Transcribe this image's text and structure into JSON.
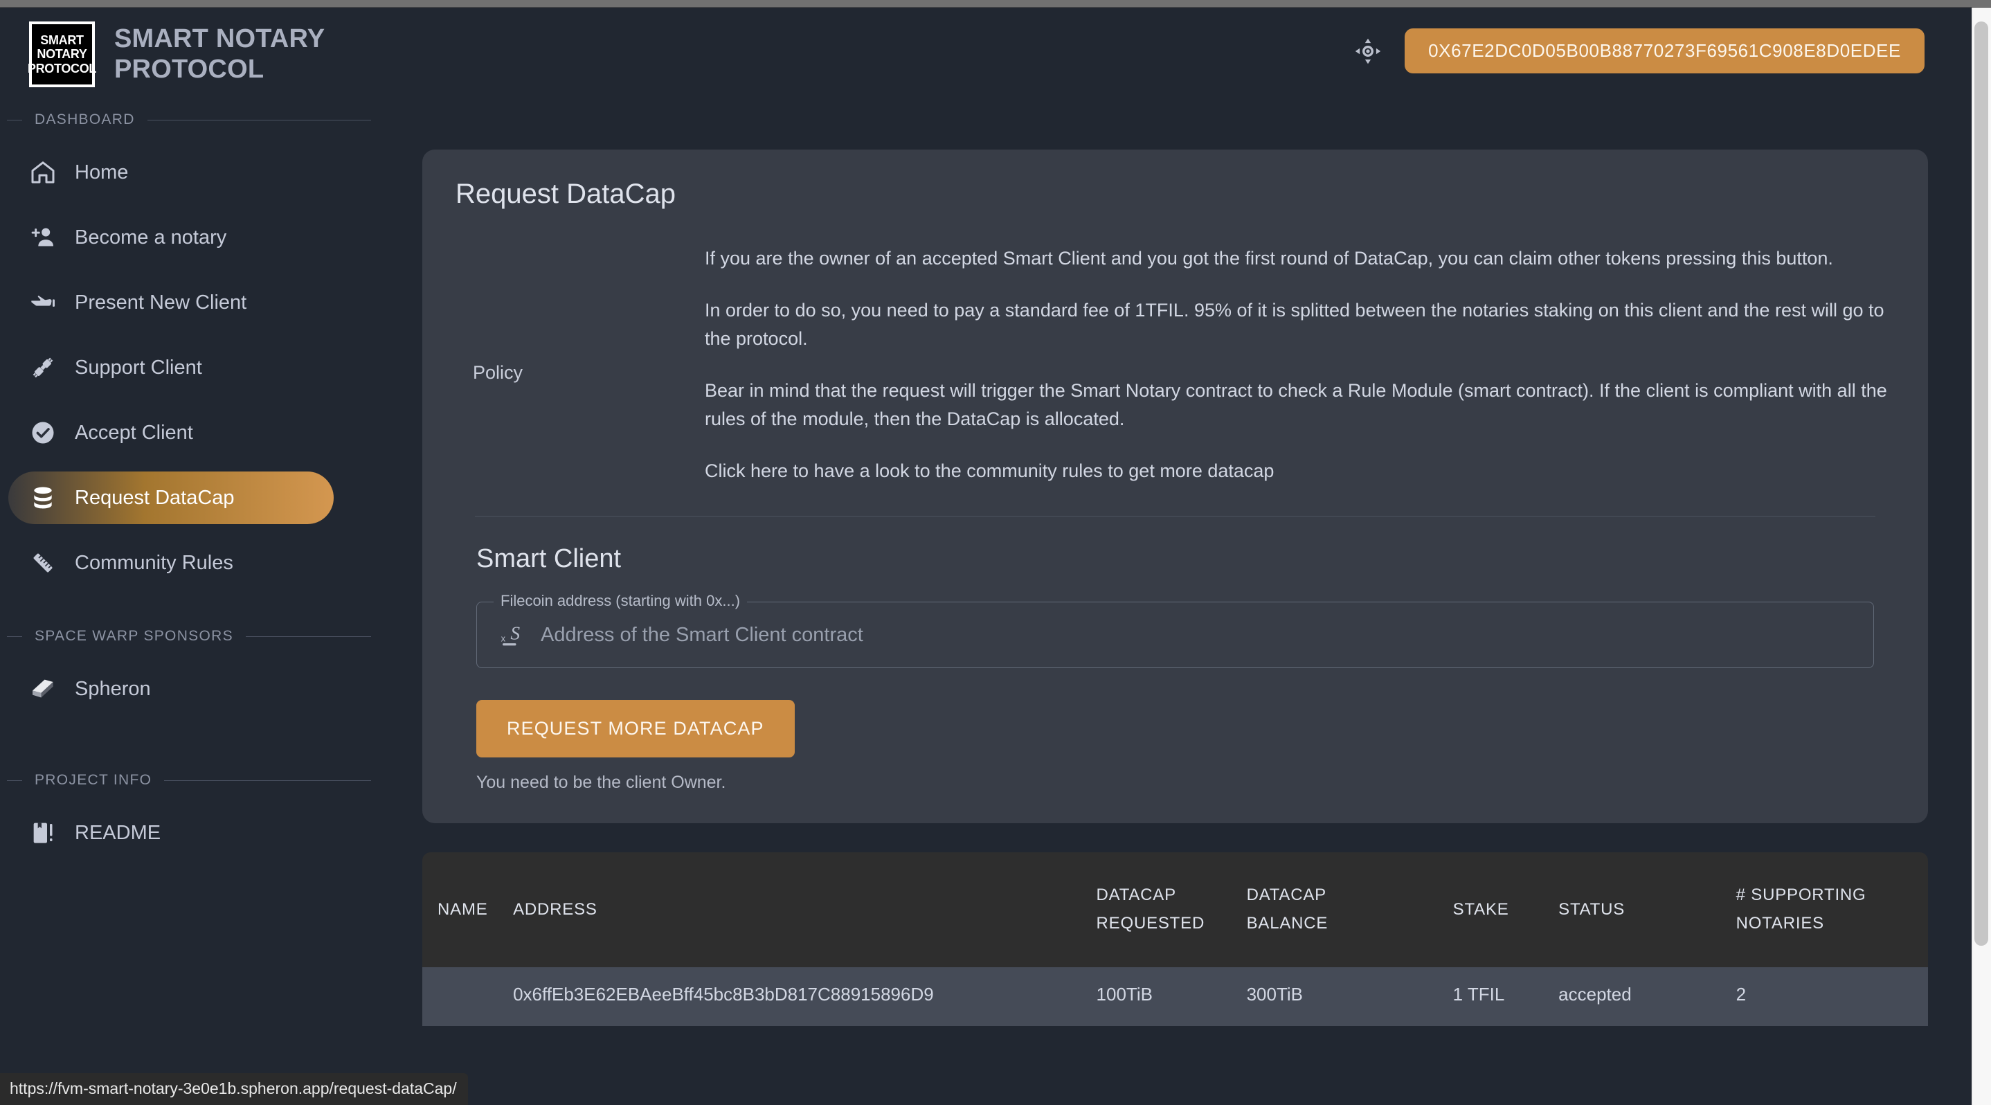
{
  "brand": {
    "logo_lines": [
      "SMART",
      "NOTARY",
      "PROTOCOL"
    ],
    "title": "SMART NOTARY PROTOCOL"
  },
  "header": {
    "theme_icon": "brightness-icon",
    "wallet_address": "0X67E2DC0D05B00B88770273F69561C908E8D0EDEE"
  },
  "sidebar": {
    "sections": [
      {
        "title": "DASHBOARD",
        "items": [
          {
            "label": "Home",
            "icon": "home-icon",
            "active": false
          },
          {
            "label": "Become a notary",
            "icon": "person-add-icon",
            "active": false
          },
          {
            "label": "Present New Client",
            "icon": "pointing-hand-icon",
            "active": false
          },
          {
            "label": "Support Client",
            "icon": "plug-connect-icon",
            "active": false
          },
          {
            "label": "Accept Client",
            "icon": "check-circle-icon",
            "active": false
          },
          {
            "label": "Request DataCap",
            "icon": "database-icon",
            "active": true
          },
          {
            "label": "Community Rules",
            "icon": "ruler-icon",
            "active": false
          }
        ]
      },
      {
        "title": "SPACE WARP SPONSORS",
        "items": [
          {
            "label": "Spheron",
            "icon": "spheron-logo-icon",
            "active": false
          }
        ]
      },
      {
        "title": "PROJECT INFO",
        "items": [
          {
            "label": "README",
            "icon": "book-icon",
            "active": false
          }
        ]
      }
    ]
  },
  "main": {
    "card_title": "Request DataCap",
    "policy_label": "Policy",
    "policy_paragraphs": [
      "If you are the owner of an accepted Smart Client and you got the first round of DataCap, you can claim other tokens pressing this button.",
      "In order to do so, you need to pay a standard fee of 1TFIL. 95% of it is splitted between the notaries staking on this client and the rest will go to the protocol.",
      "Bear in mind that the request will trigger the Smart Notary contract to check a Rule Module (smart contract). If the client is compliant with all the rules of the module, then the DataCap is allocated.",
      "Click here to have a look to the community rules to get more datacap"
    ],
    "form": {
      "title": "Smart Client",
      "field_legend": "Filecoin address (starting with 0x...)",
      "field_icon": "contract-address-icon",
      "field_value": "",
      "field_placeholder": "Address of the Smart Client contract",
      "submit_label": "REQUEST MORE DATACAP",
      "helper_text": "You need to be the client Owner."
    }
  },
  "table": {
    "columns": [
      "NAME",
      "ADDRESS",
      "DATACAP\nREQUESTED",
      "DATACAP\nBALANCE",
      "STAKE",
      "STATUS",
      "# SUPPORTING\nNOTARIES"
    ],
    "rows": [
      {
        "name": "",
        "address": "0x6ffEb3E62EBAeeBff45bc8B3bD817C88915896D9",
        "datacap_requested": "100TiB",
        "datacap_balance": "300TiB",
        "stake": "1 TFIL",
        "status": "accepted",
        "supporting_notaries": "2"
      }
    ]
  },
  "status_bar": {
    "url": "https://fvm-smart-notary-3e0e1b.spheron.app/request-dataCap/"
  },
  "colors": {
    "page_background": "#212731",
    "card_background": "#383D47",
    "accent_orange": "#CB8C44",
    "table_header_background": "#2E2E2E",
    "table_row_background": "#454B57"
  }
}
